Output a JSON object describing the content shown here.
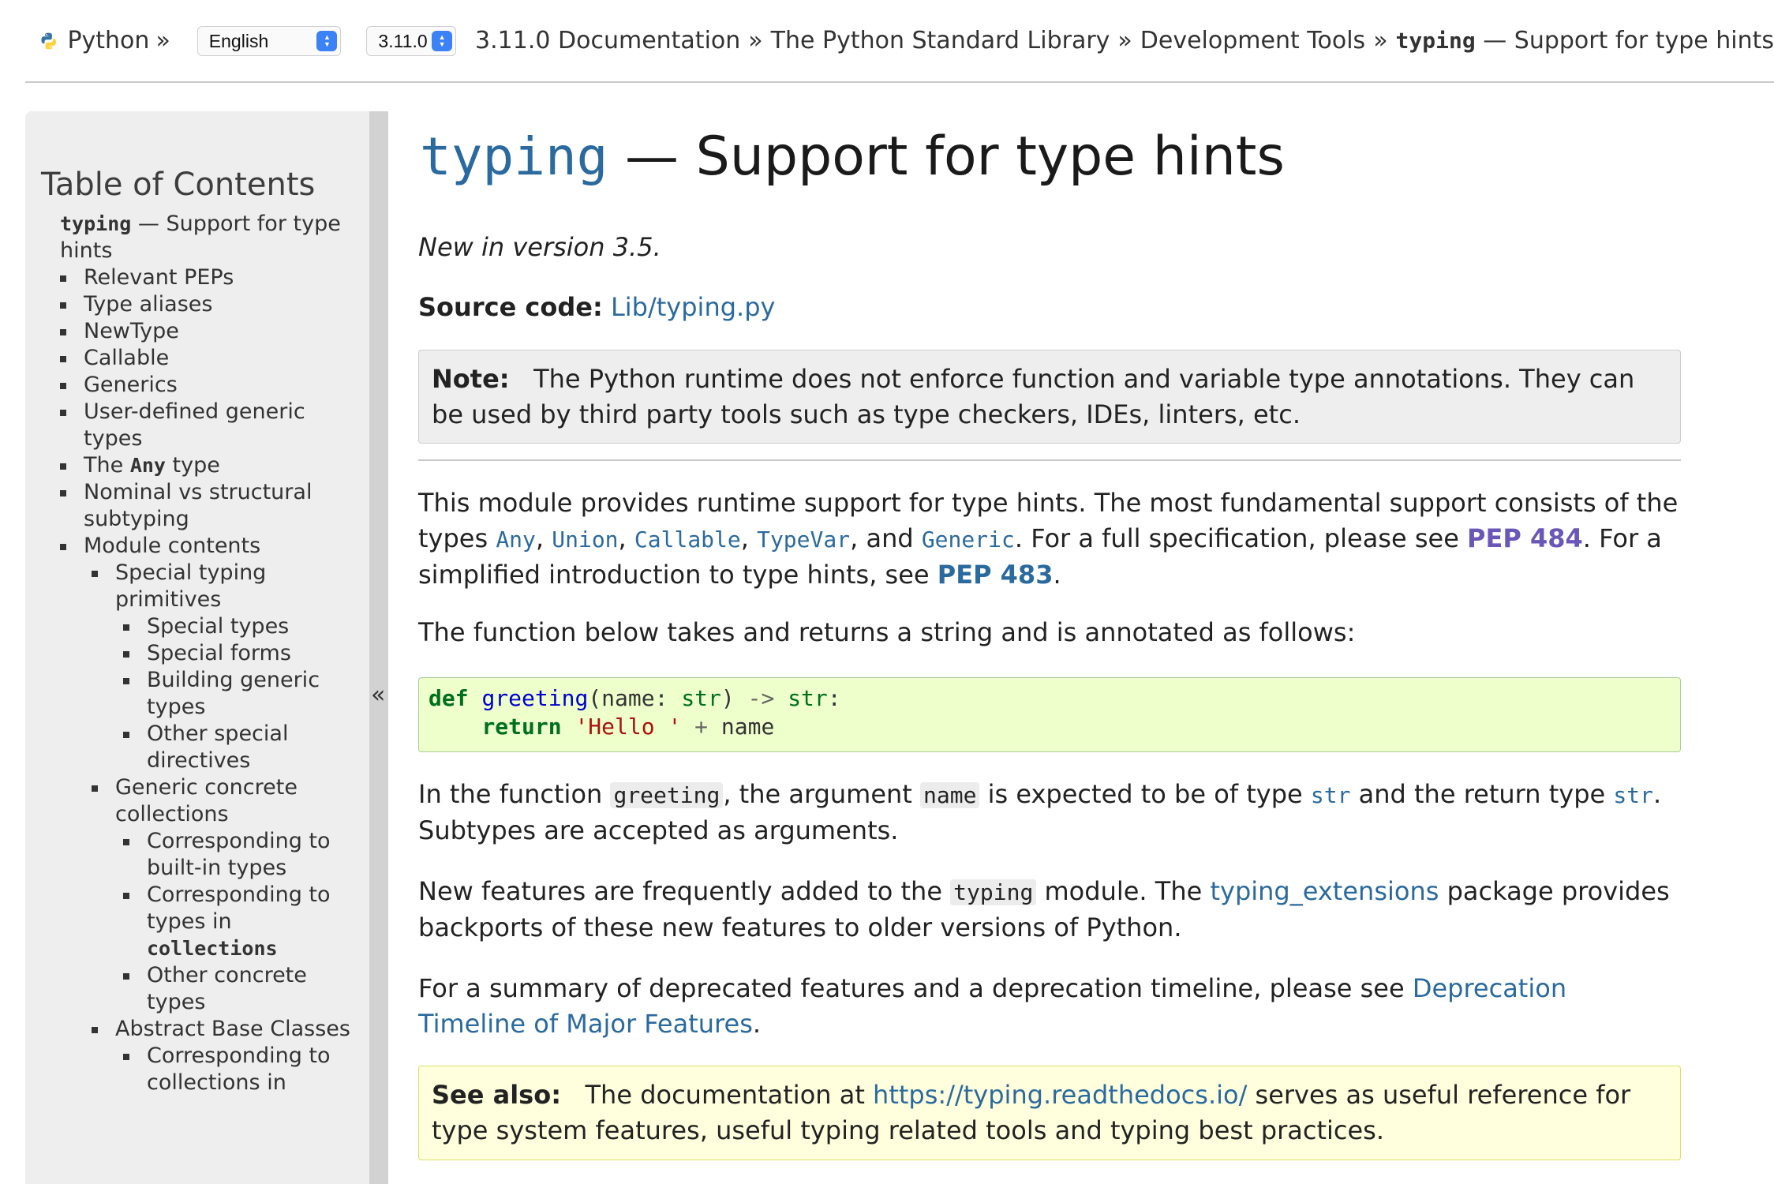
{
  "topbar": {
    "home_label": "Python",
    "home_sep": "»",
    "language": "English",
    "version": "3.11.0",
    "breadcrumbs": [
      {
        "label": "3.11.0 Documentation"
      },
      {
        "label": "The Python Standard Library"
      },
      {
        "label": "Development Tools"
      }
    ],
    "crumb_sep": "»",
    "current_code": "typing",
    "current_rest": " — Support for type hints"
  },
  "sidebar": {
    "title": "Table of Contents",
    "collapse": "«",
    "root_code": "typing",
    "root_rest": " — Support for type hints",
    "items": [
      {
        "label": "Relevant PEPs",
        "level": 0
      },
      {
        "label": "Type aliases",
        "level": 0
      },
      {
        "label": "NewType",
        "level": 0
      },
      {
        "label": "Callable",
        "level": 0
      },
      {
        "label": "Generics",
        "level": 0
      },
      {
        "label": "User-defined generic types",
        "level": 0
      },
      {
        "pre": "The ",
        "code": "Any",
        "post": " type",
        "level": 0
      },
      {
        "label": "Nominal vs structural subtyping",
        "level": 0
      },
      {
        "label": "Module contents",
        "level": 0
      },
      {
        "label": "Special typing primitives",
        "level": 1
      },
      {
        "label": "Special types",
        "level": 2
      },
      {
        "label": "Special forms",
        "level": 2
      },
      {
        "label": "Building generic types",
        "level": 2
      },
      {
        "label": "Other special directives",
        "level": 2
      },
      {
        "label": "Generic concrete collections",
        "level": 1
      },
      {
        "label": "Corresponding to built-in types",
        "level": 2
      },
      {
        "pre": "Corresponding to types in ",
        "code": "collections",
        "post": "",
        "level": 2
      },
      {
        "label": "Other concrete types",
        "level": 2
      },
      {
        "label": "Abstract Base Classes",
        "level": 1
      },
      {
        "label": "Corresponding to collections in",
        "level": 2
      }
    ]
  },
  "main": {
    "title_code": "typing",
    "title_rest": " — Support for type hints",
    "version_note": "New in version 3.5.",
    "source_label": "Source code:",
    "source_link": "Lib/typing.py",
    "note_label": "Note:",
    "note_text": "The Python runtime does not enforce function and variable type annotations. They can be used by third party tools such as type checkers, IDEs, linters, etc.",
    "p1": {
      "t1": "This module provides runtime support for type hints. The most fundamental support consists of the types ",
      "any": "Any",
      "c1": ", ",
      "union": "Union",
      "c2": ", ",
      "callable": "Callable",
      "c3": ", ",
      "typevar": "TypeVar",
      "c4": ", and ",
      "generic": "Generic",
      "t2": ". For a full specification, please see ",
      "pep484": "PEP 484",
      "t3": ". For a simplified introduction to type hints, see ",
      "pep483": "PEP 483",
      "t4": "."
    },
    "p2": "The function below takes and returns a string and is annotated as follows:",
    "code": {
      "kw_def": "def",
      "fn": "greeting",
      "lparen": "(name: ",
      "type1": "str",
      "rparen": ") ",
      "arrow": "->",
      "type2": "str",
      "colon": ":",
      "indent": "    ",
      "kw_return": "return",
      "str_lit": "'Hello '",
      "plus": "+",
      "name": "name"
    },
    "p3": {
      "t1": "In the function ",
      "c1": "greeting",
      "t2": ", the argument ",
      "c2": "name",
      "t3": " is expected to be of type ",
      "c3": "str",
      "t4": " and the return type ",
      "c4": "str",
      "t5": ". Subtypes are accepted as arguments."
    },
    "p4": {
      "t1": "New features are frequently added to the ",
      "c1": "typing",
      "t2": " module. The ",
      "link": "typing_extensions",
      "t3": " package provides backports of these new features to older versions of Python."
    },
    "p5": {
      "t1": "For a summary of deprecated features and a deprecation timeline, please see ",
      "link": "Deprecation Timeline of Major Features",
      "t2": "."
    },
    "seealso": {
      "label": "See also:",
      "t1": "The documentation at ",
      "link": "https://typing.readthedocs.io/",
      "t2": " serves as useful reference for type system features, useful typing related tools and typing best practices."
    }
  },
  "colors": {
    "link": "#2b6a9e",
    "visited_link": "#6b57b8",
    "code_bg": "#eeffcc",
    "seealso_bg": "#ffffdd",
    "note_bg": "#eeeeee"
  }
}
